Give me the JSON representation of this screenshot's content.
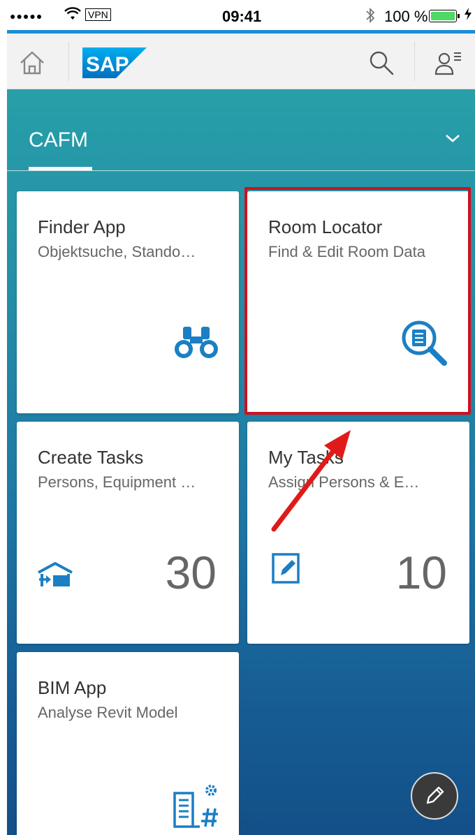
{
  "status_bar": {
    "signal": "●●●●●",
    "vpn": "VPN",
    "time": "09:41",
    "battery": "100 %"
  },
  "header": {
    "logo_text": "SAP"
  },
  "group": {
    "title": "CAFM"
  },
  "tiles": [
    {
      "title": "Finder App",
      "subtitle": "Objektsuche, Stando…",
      "icon": "binoculars-icon"
    },
    {
      "title": "Room Locator",
      "subtitle": "Find & Edit Room Data",
      "icon": "document-search-icon"
    },
    {
      "title": "Create Tasks",
      "subtitle": "Persons, Equipment …",
      "count": "30",
      "icon": "warehouse-icon"
    },
    {
      "title": "My Tasks",
      "subtitle": "Assign Persons & E…",
      "count": "10",
      "icon": "edit-icon"
    },
    {
      "title": "BIM App",
      "subtitle": "Analyse Revit Model",
      "icon": "building-settings-icon"
    }
  ],
  "colors": {
    "accent": "#1a8fd8",
    "icon_blue": "#1b7fc4",
    "highlight": "#d0101e",
    "gradient_top": "#279fa8",
    "gradient_bottom": "#134f88"
  }
}
